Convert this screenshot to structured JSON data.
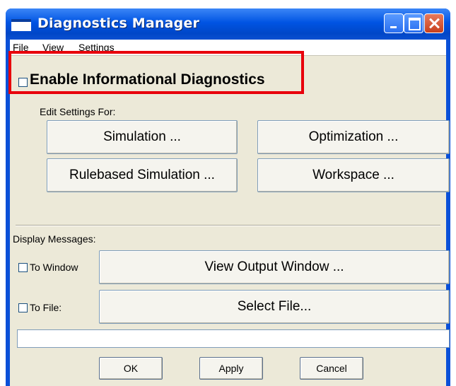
{
  "window": {
    "title": "Diagnostics  Manager"
  },
  "menu": [
    "File",
    "View",
    "Settings"
  ],
  "diagnostics": {
    "enable_label": "Enable Informational Diagnostics",
    "checked": false
  },
  "edit_settings": {
    "label": "Edit Settings For:",
    "buttons": [
      "Simulation ...",
      "Optimization ...",
      "Rulebased Simulation ...",
      "Workspace ..."
    ]
  },
  "display_messages": {
    "label": "Display Messages:",
    "to_window_label": "To Window",
    "to_file_label": "To File:",
    "view_output_button": "View Output Window ...",
    "select_file_button": "Select File...",
    "file_path_value": ""
  },
  "footer": {
    "ok": "OK",
    "apply": "Apply",
    "cancel": "Cancel"
  },
  "colors": {
    "highlight": "#e8000b",
    "titlebar": "#0054e3",
    "dialog_bg": "#ece9d8"
  }
}
